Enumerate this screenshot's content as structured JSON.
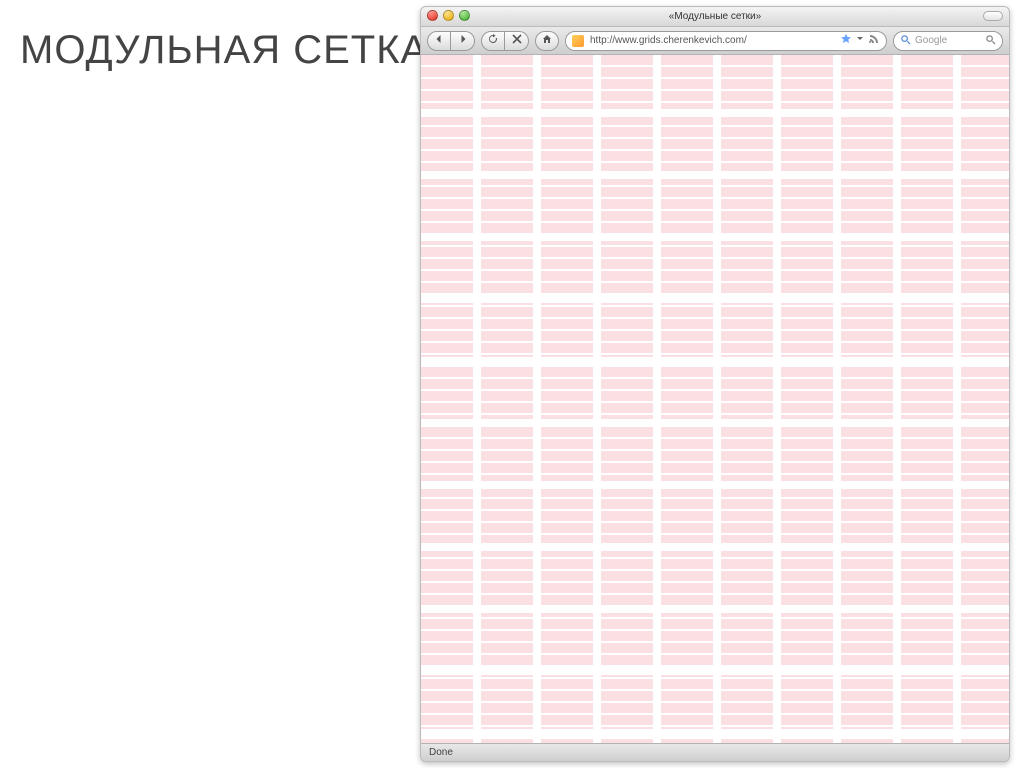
{
  "heading": "МОДУЛЬНАЯ СЕТКА",
  "browser": {
    "window_title": "«Модульные сетки»",
    "url": "http://www.grids.cherenkevich.com/",
    "search_placeholder": "Google",
    "status_text": "Done",
    "icons": {
      "back": "back-icon",
      "forward": "forward-icon",
      "reload": "reload-icon",
      "stop": "stop-icon",
      "home": "home-icon",
      "star": "star-icon",
      "feed": "feed-icon",
      "search_engine": "search-engine-icon",
      "magnify": "magnify-icon",
      "capsule": "toolbar-capsule-icon"
    }
  }
}
